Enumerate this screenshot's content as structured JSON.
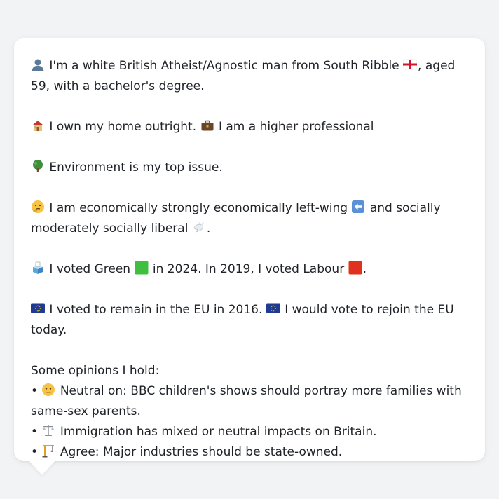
{
  "message": {
    "p1_text": "I'm a white British Atheist/Agnostic man from South Ribble",
    "p1_tail": ", aged 59, with a bachelor's degree.",
    "p2_a": "I own my home outright.",
    "p2_b": "I am a higher professional",
    "p3": "Environment is my top issue.",
    "p4_a": "I am economically strongly economically left-wing",
    "p4_b": "and socially moderately socially liberal",
    "p4_end": ".",
    "p5_a": "I voted Green",
    "p5_b": "in 2024. In 2019, I voted Labour",
    "p5_end": ".",
    "p6_a": "I voted to remain in the EU in 2016.",
    "p6_b": "I would vote to rejoin the EU today.",
    "opinions_heading": "Some opinions I hold:",
    "bullet_char": "•",
    "opinions": [
      {
        "icon": "neutral-face-icon",
        "text": "Neutral on: BBC children's shows should portray more families with same-sex parents."
      },
      {
        "icon": "scales-icon",
        "text": "Immigration has mixed or neutral impacts on Britain."
      },
      {
        "icon": "construction-crane-icon",
        "text": "Agree: Major industries should be state-owned."
      }
    ]
  },
  "colors": {
    "background": "#f2f3f5",
    "card": "#ffffff",
    "text": "#1f2328",
    "green_square": "#3fbf3f",
    "red_square": "#e0301e",
    "eu_blue": "#1f3a93"
  }
}
